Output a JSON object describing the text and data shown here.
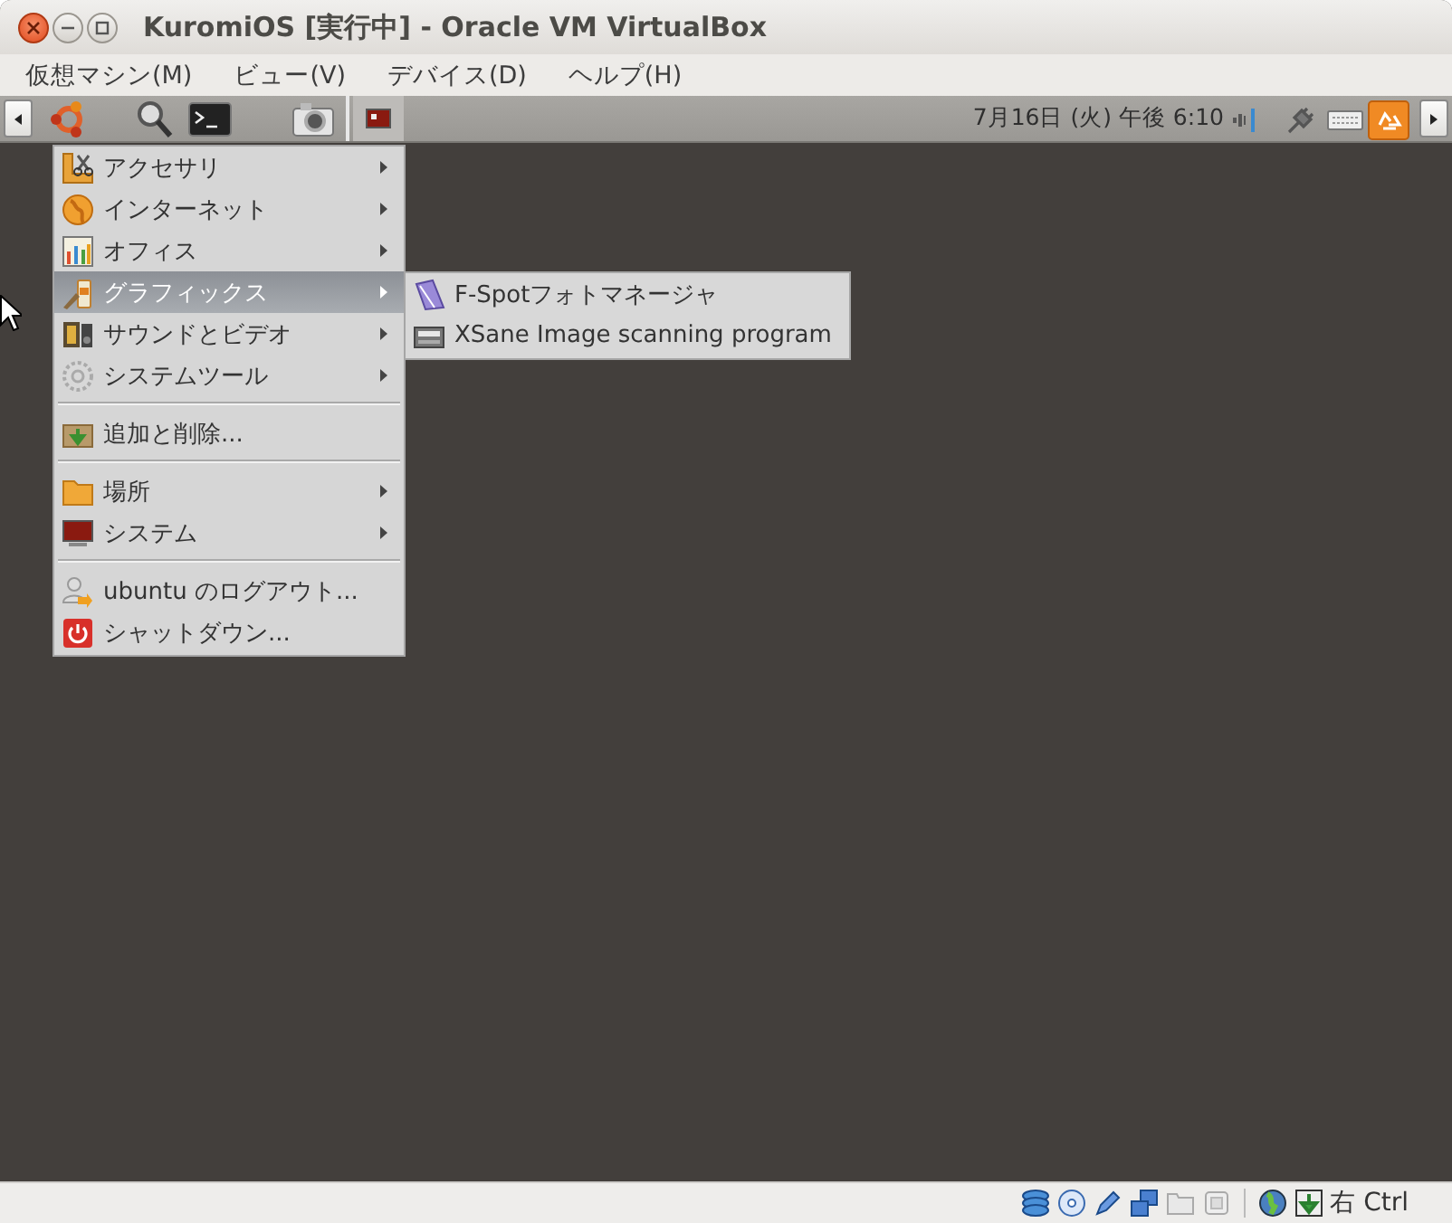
{
  "window": {
    "title": "KuromiOS [実行中] - Oracle VM VirtualBox"
  },
  "menu_bar": [
    "仮想マシン(M)",
    "ビュー(V)",
    "デバイス(D)",
    "ヘルプ(H)"
  ],
  "guest_panel": {
    "clock": "7月16日 (火) 午後 6:10"
  },
  "applications_menu": {
    "items": [
      {
        "kind": "item",
        "label": "アクセサリ",
        "has_submenu": true,
        "selected": false
      },
      {
        "kind": "item",
        "label": "インターネット",
        "has_submenu": true,
        "selected": false
      },
      {
        "kind": "item",
        "label": "オフィス",
        "has_submenu": true,
        "selected": false
      },
      {
        "kind": "item",
        "label": "グラフィックス",
        "has_submenu": true,
        "selected": true
      },
      {
        "kind": "item",
        "label": "サウンドとビデオ",
        "has_submenu": true,
        "selected": false
      },
      {
        "kind": "item",
        "label": "システムツール",
        "has_submenu": true,
        "selected": false
      },
      {
        "kind": "separator"
      },
      {
        "kind": "item",
        "label": "追加と削除...",
        "has_submenu": false,
        "selected": false
      },
      {
        "kind": "separator"
      },
      {
        "kind": "item",
        "label": "場所",
        "has_submenu": true,
        "selected": false
      },
      {
        "kind": "item",
        "label": "システム",
        "has_submenu": true,
        "selected": false
      },
      {
        "kind": "separator"
      },
      {
        "kind": "item",
        "label": "ubuntu のログアウト...",
        "has_submenu": false,
        "selected": false
      },
      {
        "kind": "item",
        "label": "シャットダウン...",
        "has_submenu": false,
        "selected": false
      }
    ]
  },
  "submenu": {
    "items": [
      {
        "label": "F-Spotフォトマネージャ"
      },
      {
        "label": "XSane Image scanning program"
      }
    ]
  },
  "status_bar": {
    "host_key": "右 Ctrl"
  }
}
